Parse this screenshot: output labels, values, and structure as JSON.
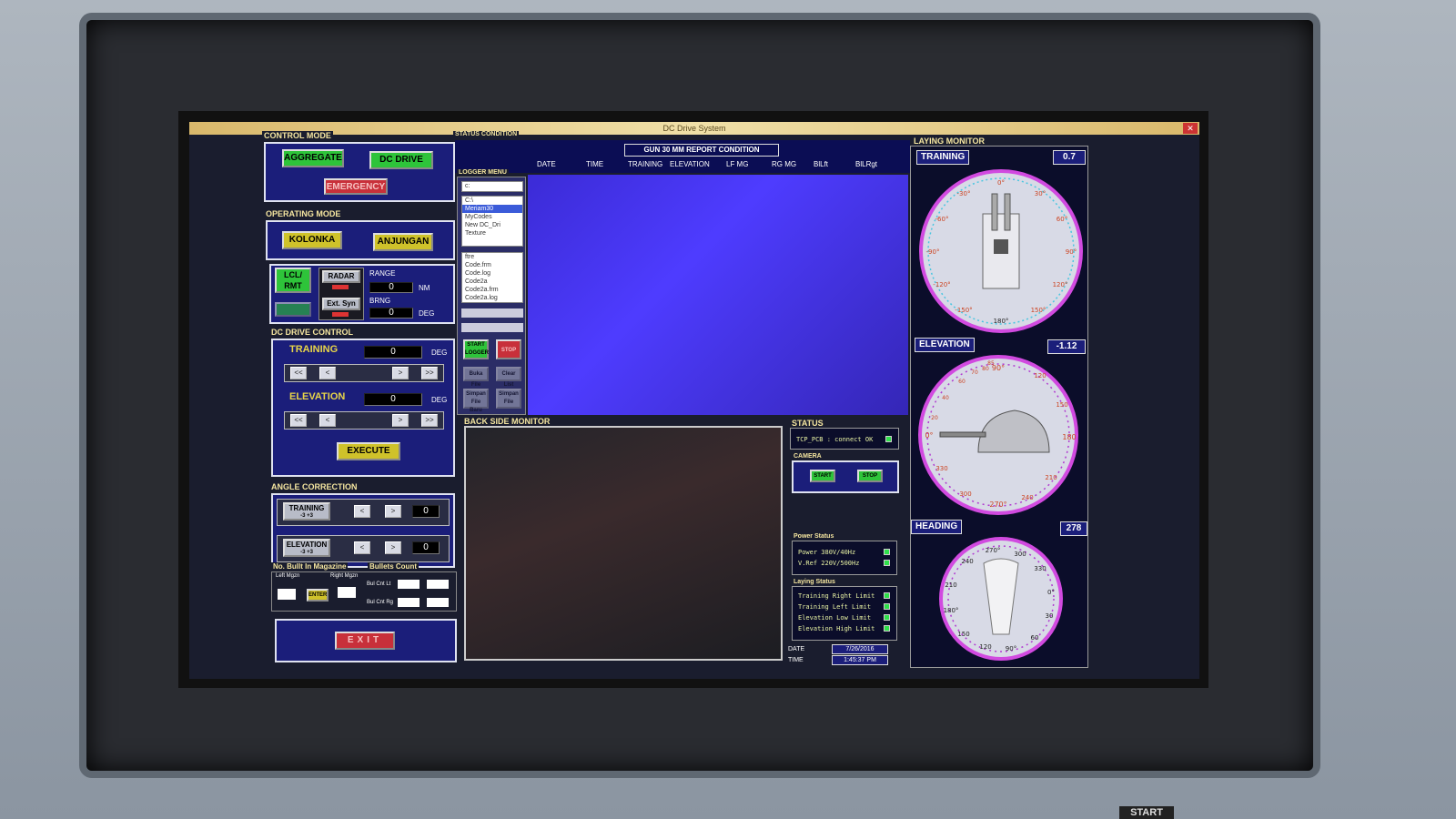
{
  "window": {
    "title": "DC Drive System",
    "close": "✕"
  },
  "control_mode": {
    "title": "CONTROL MODE",
    "aggregate": "AGGREGATE",
    "dc_drive": "DC DRIVE",
    "emergency": "EMERGENCY"
  },
  "operating_mode": {
    "title": "OPERATING MODE",
    "kolonka": "KOLONKA",
    "anjungan": "ANJUNGAN",
    "lcl_rmt": "LCL/ RMT",
    "radar": "RADAR",
    "ext_syn": "Ext. Syn",
    "range_label": "RANGE",
    "range_value": "0",
    "range_unit": "NM",
    "brng_label": "BRNG",
    "brng_value": "0",
    "brng_unit": "DEG"
  },
  "dc_drive_control": {
    "title": "DC DRIVE CONTROL",
    "training_label": "TRAINING",
    "training_value": "0",
    "training_unit": "DEG",
    "elevation_label": "ELEVATION",
    "elevation_value": "0",
    "elevation_unit": "DEG",
    "fast_left": "<<",
    "left": "<",
    "right": ">",
    "fast_right": ">>",
    "execute": "EXECUTE"
  },
  "angle_correction": {
    "title": "ANGLE CORRECTION",
    "training": "TRAINING",
    "training_range": "-3       +3",
    "training_value": "0",
    "elevation": "ELEVATION",
    "elevation_range": "-3       +3",
    "elevation_value": "0",
    "dec": "<",
    "inc": ">"
  },
  "magazine": {
    "title": "No. Bullt In Magazine",
    "left_mgzn": "Left Mgzn",
    "right_mgzn": "Right Mgzn",
    "enter": "ENTER",
    "bullets_title": "Bullets Count",
    "bul_cnt_lt": "Bul Cnt Lt",
    "bul_cnt_rg": "Bul Cnt Rg"
  },
  "exit": "EXIT",
  "status_condition": {
    "title": "STATUS CONDITION",
    "report_title": "GUN 30 MM  REPORT CONDITION",
    "columns": [
      "DATE",
      "TIME",
      "TRAINING",
      "ELEVATION",
      "LF MG",
      "RG MG",
      "BlLft",
      "BlLRgt"
    ]
  },
  "logger_menu": {
    "title": "LOGGER MENU",
    "drive": "c:",
    "folders": [
      "C:\\",
      "Meriam30",
      "MyCodes",
      "New DC_Dri",
      "Texture"
    ],
    "files": [
      "ftre",
      "Code.frm",
      "Code.log",
      "Code2a",
      "Code2a.frm",
      "Code2a.log"
    ],
    "start_logger": "START LOGGER",
    "stop": "STOP",
    "buka_file": "Buka File",
    "clear_list": "Clear List",
    "simpan_file_baru": "Simpan File Baru",
    "simpan_file": "Simpan File"
  },
  "back_side_monitor": {
    "title": "BACK SIDE MONITOR"
  },
  "status": {
    "title": "STATUS",
    "tcp": "TCP_PCB : connect OK",
    "camera_title": "CAMERA",
    "camera_start": "START",
    "camera_stop": "STOP",
    "power_title": "Power Status",
    "power_items": [
      "Power 380V/40Hz",
      "V.Ref  220V/500Hz"
    ],
    "laying_title": "Laying Status",
    "laying_items": [
      "Training Right Limit",
      "Training Left Limit",
      "Elevation Low Limit",
      "Elevation High Limit"
    ],
    "date_label": "DATE",
    "date_value": "7/26/2016",
    "time_label": "TIME",
    "time_value": "1:45:37 PM"
  },
  "laying_monitor": {
    "title": "LAYING MONITOR",
    "training_label": "TRAINING",
    "training_value": "0.7",
    "elevation_label": "ELEVATION",
    "elevation_value": "-1.12",
    "heading_label": "HEADING",
    "heading_value": "278",
    "training_ticks": [
      "0°",
      "30°",
      "60°",
      "90°",
      "120°",
      "150°",
      "180°",
      "-150°",
      "-120°",
      "-90°",
      "-60°",
      "-30°"
    ],
    "elevation_ticks": [
      "90°",
      "120",
      "150",
      "180",
      "210",
      "240",
      "270°",
      "300",
      "330",
      "0°",
      "20",
      "40",
      "60",
      "70",
      "80",
      "85"
    ],
    "heading_ticks": [
      "270°",
      "300",
      "330",
      "0°",
      "30",
      "60",
      "90°",
      "120",
      "150",
      "180°",
      "210",
      "240"
    ]
  },
  "bezel": {
    "start": "START"
  }
}
